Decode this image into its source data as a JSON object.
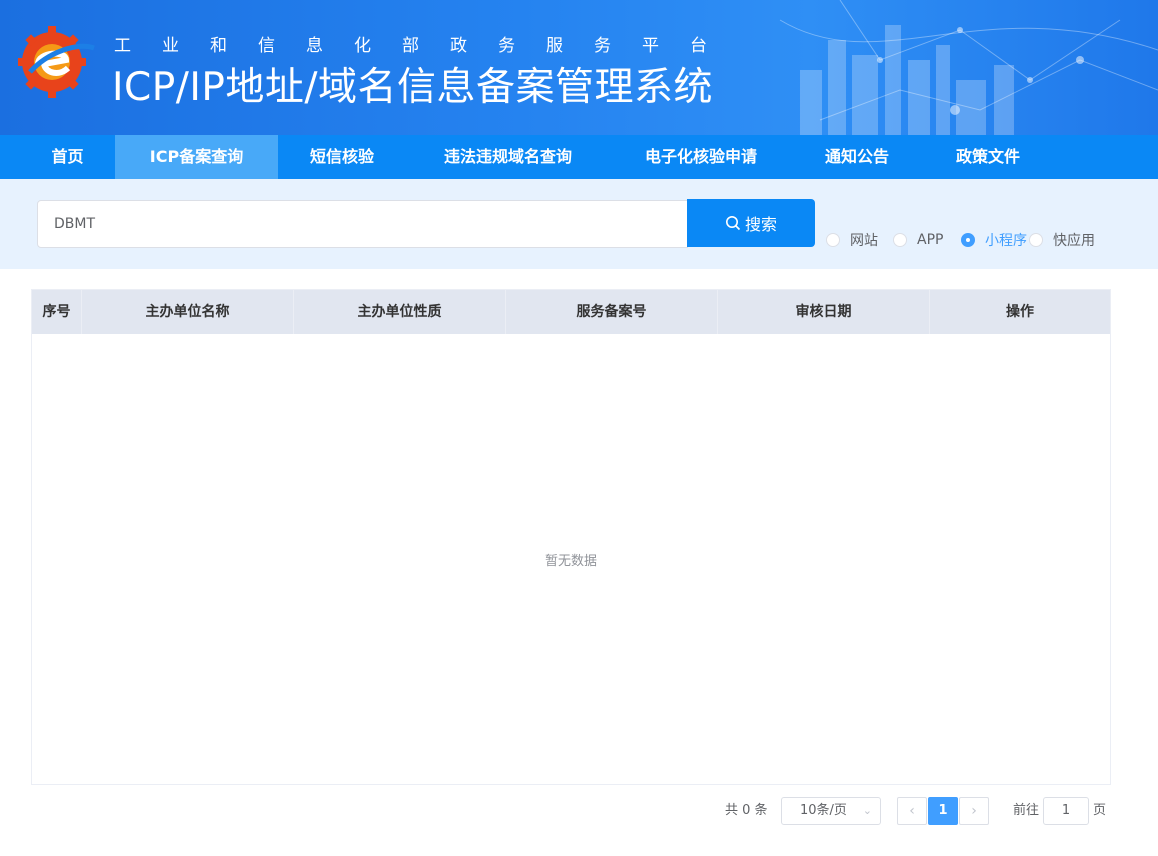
{
  "header": {
    "subtitle": "工业和信息化部政务服务平台",
    "title": "ICP/IP地址/域名信息备案管理系统"
  },
  "nav": {
    "items": [
      {
        "label": "首页",
        "active": false
      },
      {
        "label": "ICP备案查询",
        "active": true
      },
      {
        "label": "短信核验",
        "active": false
      },
      {
        "label": "违法违规域名查询",
        "active": false
      },
      {
        "label": "电子化核验申请",
        "active": false
      },
      {
        "label": "通知公告",
        "active": false
      },
      {
        "label": "政策文件",
        "active": false
      }
    ]
  },
  "search": {
    "value": "DBMT",
    "button_label": "搜索",
    "button_icon": "search-icon",
    "types": [
      {
        "label": "网站",
        "checked": false
      },
      {
        "label": "APP",
        "checked": false
      },
      {
        "label": "小程序",
        "checked": true
      },
      {
        "label": "快应用",
        "checked": false
      }
    ]
  },
  "table": {
    "columns": [
      "序号",
      "主办单位名称",
      "主办单位性质",
      "服务备案号",
      "审核日期",
      "操作"
    ],
    "rows": [],
    "empty_text": "暂无数据"
  },
  "pagination": {
    "total_text": "共 0 条",
    "page_size": "10条/页",
    "current_page": "1",
    "goto_label": "前往",
    "goto_value": "1",
    "goto_suffix": "页"
  },
  "colors": {
    "nav_bg": "#0a88f5",
    "nav_active": "#48a9f8",
    "accent": "#409eff"
  }
}
